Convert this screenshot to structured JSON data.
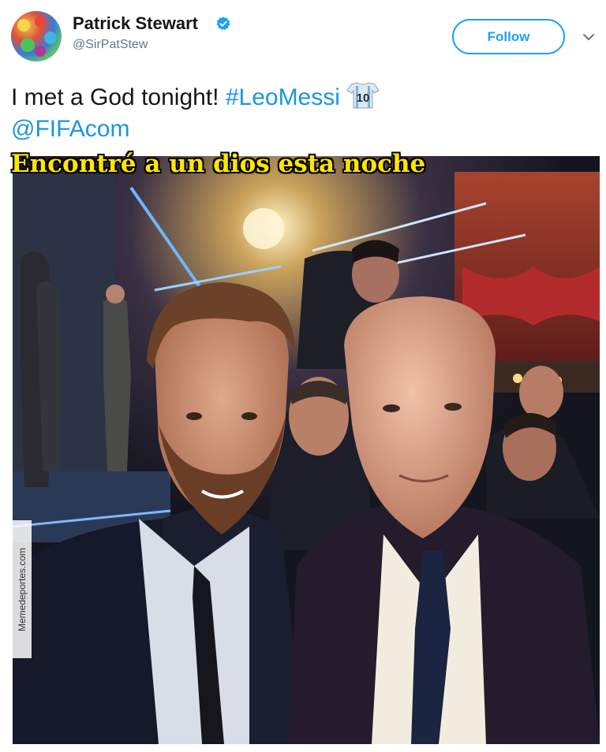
{
  "author": {
    "name": "Patrick Stewart",
    "handle": "@SirPatStew",
    "verified_icon": "verified-badge-icon"
  },
  "actions": {
    "follow_label": "Follow",
    "menu_icon": "chevron-down-icon"
  },
  "tweet": {
    "text_plain": "I met a God tonight! ",
    "hashtag": "#LeoMessi",
    "emoji": "argentina-jersey-10-icon",
    "mention": "@FIFAcom"
  },
  "media": {
    "caption": "Encontré a un dios esta noche",
    "watermark": "Memedeportes.com"
  },
  "colors": {
    "link": "#1b95e0",
    "follow": "#1da1f2",
    "handle": "#657786",
    "caption": "#ffe600"
  }
}
